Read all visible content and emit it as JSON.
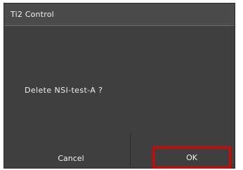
{
  "window": {
    "title": "Ti2 Control"
  },
  "dialog": {
    "message": "Delete NSI-test-A ?",
    "cancel_label": "Cancel",
    "ok_label": "OK"
  },
  "colors": {
    "background": "#3f3f3f",
    "titlebar": "#4b4b4b",
    "text": "#f0f0f0",
    "highlight": "#e00000"
  }
}
